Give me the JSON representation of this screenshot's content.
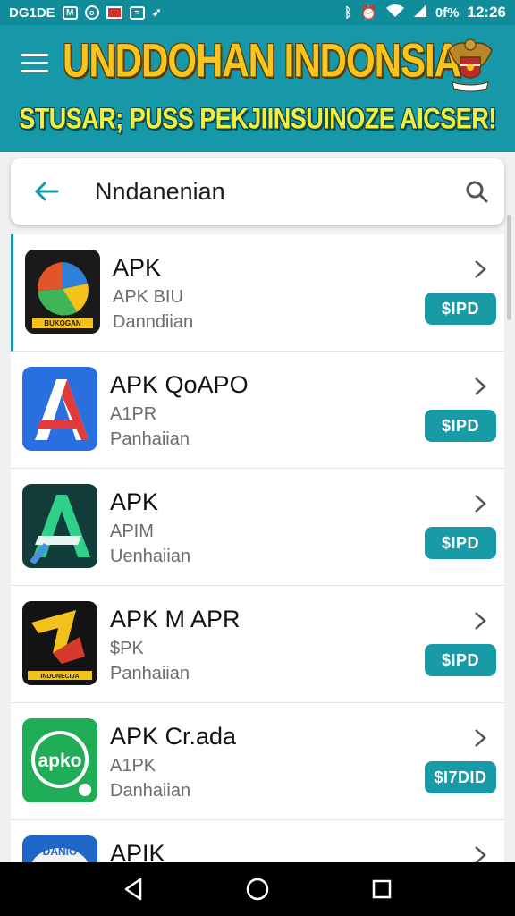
{
  "status_bar": {
    "left_text": "DG1DE",
    "battery_text": "0f%",
    "time": "12:26",
    "icons": [
      "message-icon",
      "camera-icon",
      "flag-icon",
      "mail-icon",
      "location-icon",
      "bluetooth-icon",
      "alarm-icon",
      "wifi-icon",
      "signal-icon"
    ]
  },
  "header": {
    "title": "UNDDOHAN INDONSIA",
    "subtitle": "STUSAR; PUSS PEKJIINSUINOZE AICSER!",
    "title_color": "#f7c51d",
    "subtitle_color": "#f4ee3f",
    "background": "#1798a8"
  },
  "search": {
    "query": "Nndanenian"
  },
  "apps": [
    {
      "name": "APK",
      "subtitle": "APK BIU",
      "developer": "Danndiian",
      "button": "$IPD",
      "icon": "pie-logo-icon",
      "icon_text": "BUKOGAN"
    },
    {
      "name": "APK QoAPO",
      "subtitle": "A1PR",
      "developer": "Panhaiian",
      "button": "$IPD",
      "icon": "letter-a-blue-icon",
      "icon_text": ""
    },
    {
      "name": "APK",
      "subtitle": "APIM",
      "developer": "Uenhaiian",
      "button": "$IPD",
      "icon": "letter-a-green-icon",
      "icon_text": ""
    },
    {
      "name": "APK M APR",
      "subtitle": "$PK",
      "developer": "Panhaiian",
      "button": "$IPD",
      "icon": "folded-arrow-icon",
      "icon_text": "INDONECIJA"
    },
    {
      "name": "APK Cr.ada",
      "subtitle": "A1PK",
      "developer": "Danhaiian",
      "button": "$I7DID",
      "icon": "apko-circle-icon",
      "icon_text": "apko"
    },
    {
      "name": "APIK",
      "subtitle": "",
      "developer": "",
      "button": "",
      "icon": "badge-logo-icon",
      "icon_text": "DANIO"
    }
  ],
  "colors": {
    "accent": "#199aa7",
    "status_bar": "#118c9a"
  }
}
